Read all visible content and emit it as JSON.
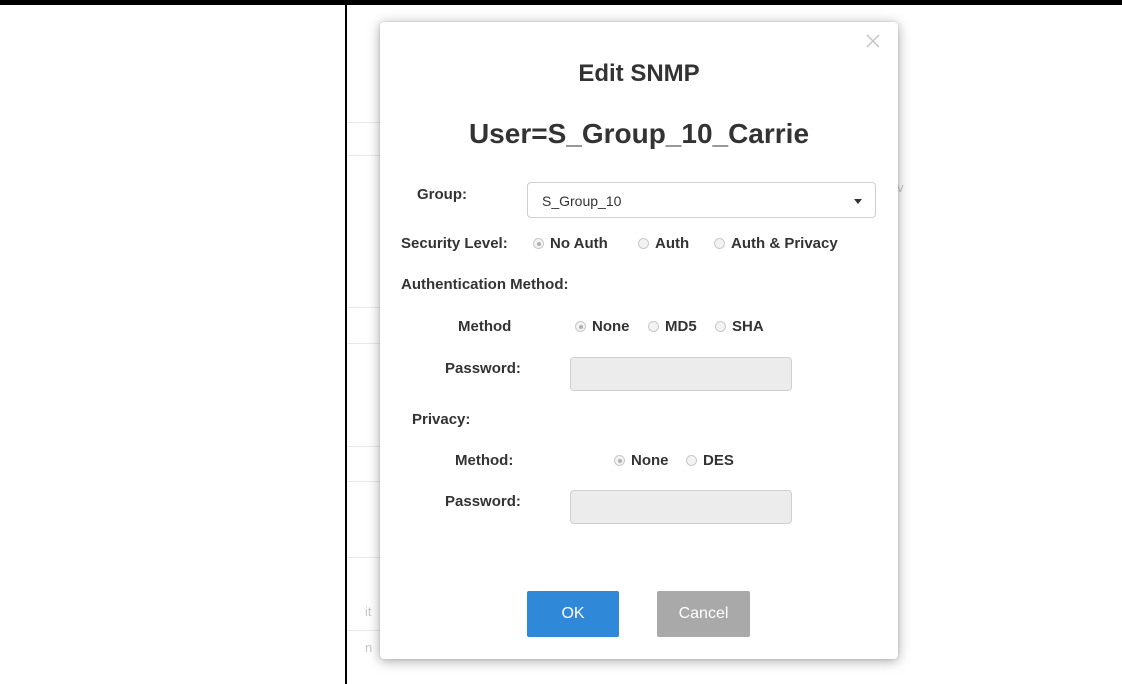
{
  "dialog": {
    "title_line1": "Edit SNMP",
    "title_line2": "User=S_Group_10_Carrie",
    "close_icon": "close-icon"
  },
  "group": {
    "label": "Group:",
    "selected": "S_Group_10"
  },
  "security_level": {
    "label": "Security Level:",
    "options": [
      "No Auth",
      "Auth",
      "Auth & Privacy"
    ],
    "selected": "No Auth"
  },
  "authentication": {
    "heading": "Authentication Method:",
    "method_label": "Method",
    "options": [
      "None",
      "MD5",
      "SHA"
    ],
    "selected": "None",
    "password_label": "Password:",
    "password_value": ""
  },
  "privacy": {
    "heading": "Privacy:",
    "method_label": "Method:",
    "options": [
      "None",
      "DES"
    ],
    "selected": "None",
    "password_label": "Password:",
    "password_value": ""
  },
  "buttons": {
    "ok": "OK",
    "cancel": "Cancel"
  },
  "colors": {
    "ok_button": "#2f88d8",
    "cancel_button": "#a9a9a9",
    "text": "#333333"
  }
}
